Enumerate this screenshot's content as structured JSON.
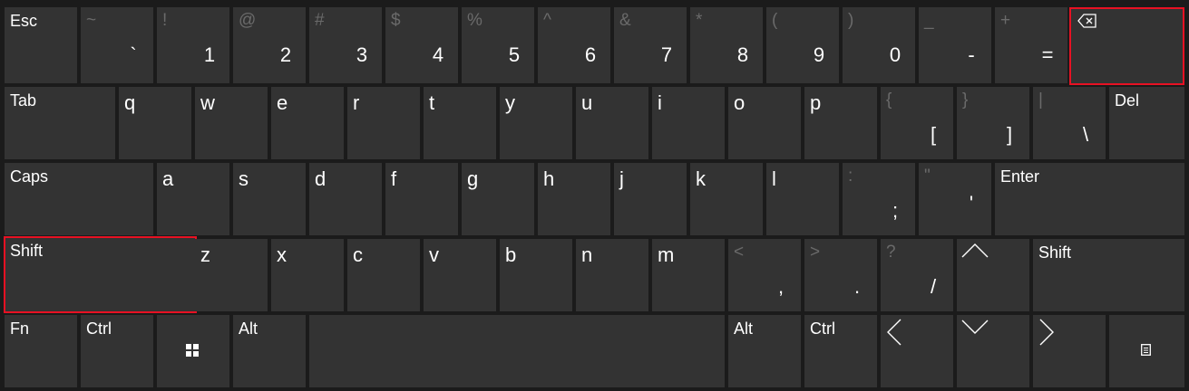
{
  "keyboard": {
    "colors": {
      "background": "#1b1b1b",
      "key": "#333333",
      "text": "#ffffff",
      "secondary": "#6a6a6a",
      "highlight": "#e81123"
    },
    "row1": {
      "esc": "Esc",
      "k1": {
        "sec": "~",
        "pri": "`"
      },
      "k2": {
        "sec": "!",
        "pri": "1"
      },
      "k3": {
        "sec": "@",
        "pri": "2"
      },
      "k4": {
        "sec": "#",
        "pri": "3"
      },
      "k5": {
        "sec": "$",
        "pri": "4"
      },
      "k6": {
        "sec": "%",
        "pri": "5"
      },
      "k7": {
        "sec": "^",
        "pri": "6"
      },
      "k8": {
        "sec": "&",
        "pri": "7"
      },
      "k9": {
        "sec": "*",
        "pri": "8"
      },
      "k10": {
        "sec": "(",
        "pri": "9"
      },
      "k11": {
        "sec": ")",
        "pri": "0"
      },
      "k12": {
        "sec": "_",
        "pri": "-"
      },
      "k13": {
        "sec": "+",
        "pri": "="
      },
      "backspace_icon": "backspace-icon"
    },
    "row2": {
      "tab": "Tab",
      "letters": [
        "q",
        "w",
        "e",
        "r",
        "t",
        "y",
        "u",
        "i",
        "o",
        "p"
      ],
      "lbracket": {
        "sec": "{",
        "pri": "["
      },
      "rbracket": {
        "sec": "}",
        "pri": "]"
      },
      "backslash": {
        "sec": "|",
        "pri": "\\"
      },
      "del": "Del"
    },
    "row3": {
      "caps": "Caps",
      "letters": [
        "a",
        "s",
        "d",
        "f",
        "g",
        "h",
        "j",
        "k",
        "l"
      ],
      "semicolon": {
        "sec": ":",
        "pri": ";"
      },
      "quote": {
        "sec": "\"",
        "pri": "'"
      },
      "enter": "Enter"
    },
    "row4": {
      "shift_left": "Shift",
      "letters": [
        "z",
        "x",
        "c",
        "v",
        "b",
        "n",
        "m"
      ],
      "comma": {
        "sec": "<",
        "pri": ","
      },
      "period": {
        "sec": ">",
        "pri": "."
      },
      "slash": {
        "sec": "?",
        "pri": "/"
      },
      "up_icon": "chevron-up-icon",
      "shift_right": "Shift"
    },
    "row5": {
      "fn": "Fn",
      "ctrl_left": "Ctrl",
      "win_icon": "windows-logo-icon",
      "alt_left": "Alt",
      "alt_right": "Alt",
      "ctrl_right": "Ctrl",
      "left_icon": "chevron-left-icon",
      "down_icon": "chevron-down-icon",
      "right_icon": "chevron-right-icon",
      "menu_icon": "menu-icon"
    },
    "highlighted_keys": [
      "backspace",
      "shift-left"
    ]
  }
}
